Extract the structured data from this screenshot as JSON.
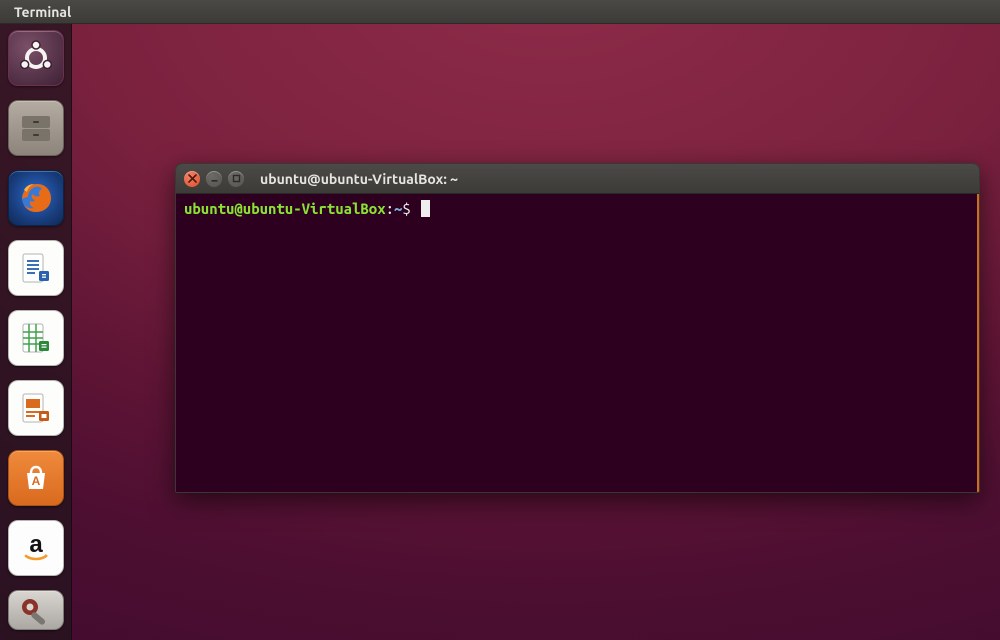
{
  "menubar": {
    "title": "Terminal"
  },
  "launcher": {
    "items": [
      {
        "name": "Dash"
      },
      {
        "name": "Files"
      },
      {
        "name": "Firefox Web Browser"
      },
      {
        "name": "LibreOffice Writer"
      },
      {
        "name": "LibreOffice Calc"
      },
      {
        "name": "LibreOffice Impress"
      },
      {
        "name": "Ubuntu Software"
      },
      {
        "name": "Amazon"
      },
      {
        "name": "System Settings"
      }
    ]
  },
  "terminal": {
    "window_title": "ubuntu@ubuntu-VirtualBox: ~",
    "prompt": {
      "user_host": "ubuntu@ubuntu-VirtualBox",
      "colon": ":",
      "path": "~",
      "symbol": "$"
    },
    "command": ""
  },
  "colors": {
    "terminal_bg": "#2c001e",
    "prompt_green": "#8ae234",
    "prompt_blue": "#7fa8d6",
    "ubuntu_orange": "#dd4814"
  }
}
